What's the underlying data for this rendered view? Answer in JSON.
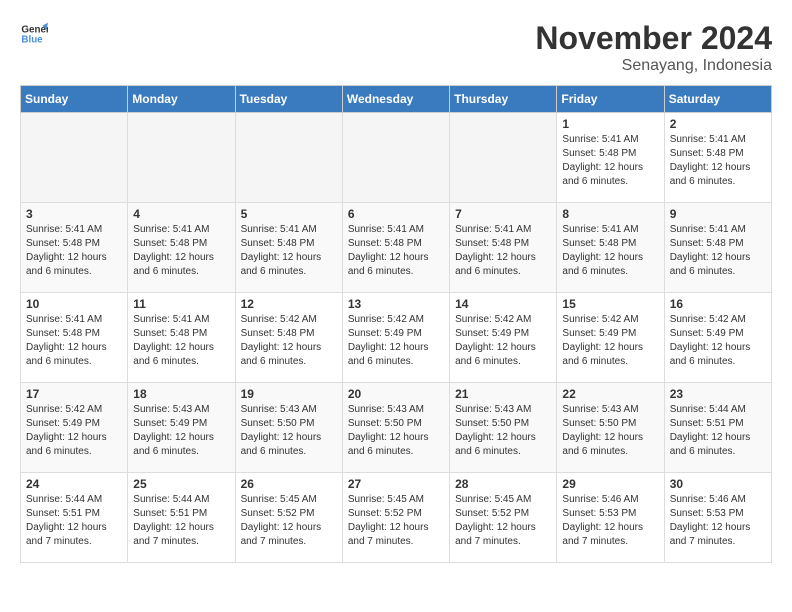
{
  "header": {
    "logo_line1": "General",
    "logo_line2": "Blue",
    "month": "November 2024",
    "location": "Senayang, Indonesia"
  },
  "days_of_week": [
    "Sunday",
    "Monday",
    "Tuesday",
    "Wednesday",
    "Thursday",
    "Friday",
    "Saturday"
  ],
  "weeks": [
    [
      {
        "day": "",
        "empty": true
      },
      {
        "day": "",
        "empty": true
      },
      {
        "day": "",
        "empty": true
      },
      {
        "day": "",
        "empty": true
      },
      {
        "day": "",
        "empty": true
      },
      {
        "day": "1",
        "sunrise": "5:41 AM",
        "sunset": "5:48 PM",
        "daylight": "12 hours and 6 minutes."
      },
      {
        "day": "2",
        "sunrise": "5:41 AM",
        "sunset": "5:48 PM",
        "daylight": "12 hours and 6 minutes."
      }
    ],
    [
      {
        "day": "3",
        "sunrise": "5:41 AM",
        "sunset": "5:48 PM",
        "daylight": "12 hours and 6 minutes."
      },
      {
        "day": "4",
        "sunrise": "5:41 AM",
        "sunset": "5:48 PM",
        "daylight": "12 hours and 6 minutes."
      },
      {
        "day": "5",
        "sunrise": "5:41 AM",
        "sunset": "5:48 PM",
        "daylight": "12 hours and 6 minutes."
      },
      {
        "day": "6",
        "sunrise": "5:41 AM",
        "sunset": "5:48 PM",
        "daylight": "12 hours and 6 minutes."
      },
      {
        "day": "7",
        "sunrise": "5:41 AM",
        "sunset": "5:48 PM",
        "daylight": "12 hours and 6 minutes."
      },
      {
        "day": "8",
        "sunrise": "5:41 AM",
        "sunset": "5:48 PM",
        "daylight": "12 hours and 6 minutes."
      },
      {
        "day": "9",
        "sunrise": "5:41 AM",
        "sunset": "5:48 PM",
        "daylight": "12 hours and 6 minutes."
      }
    ],
    [
      {
        "day": "10",
        "sunrise": "5:41 AM",
        "sunset": "5:48 PM",
        "daylight": "12 hours and 6 minutes."
      },
      {
        "day": "11",
        "sunrise": "5:41 AM",
        "sunset": "5:48 PM",
        "daylight": "12 hours and 6 minutes."
      },
      {
        "day": "12",
        "sunrise": "5:42 AM",
        "sunset": "5:48 PM",
        "daylight": "12 hours and 6 minutes."
      },
      {
        "day": "13",
        "sunrise": "5:42 AM",
        "sunset": "5:49 PM",
        "daylight": "12 hours and 6 minutes."
      },
      {
        "day": "14",
        "sunrise": "5:42 AM",
        "sunset": "5:49 PM",
        "daylight": "12 hours and 6 minutes."
      },
      {
        "day": "15",
        "sunrise": "5:42 AM",
        "sunset": "5:49 PM",
        "daylight": "12 hours and 6 minutes."
      },
      {
        "day": "16",
        "sunrise": "5:42 AM",
        "sunset": "5:49 PM",
        "daylight": "12 hours and 6 minutes."
      }
    ],
    [
      {
        "day": "17",
        "sunrise": "5:42 AM",
        "sunset": "5:49 PM",
        "daylight": "12 hours and 6 minutes."
      },
      {
        "day": "18",
        "sunrise": "5:43 AM",
        "sunset": "5:49 PM",
        "daylight": "12 hours and 6 minutes."
      },
      {
        "day": "19",
        "sunrise": "5:43 AM",
        "sunset": "5:50 PM",
        "daylight": "12 hours and 6 minutes."
      },
      {
        "day": "20",
        "sunrise": "5:43 AM",
        "sunset": "5:50 PM",
        "daylight": "12 hours and 6 minutes."
      },
      {
        "day": "21",
        "sunrise": "5:43 AM",
        "sunset": "5:50 PM",
        "daylight": "12 hours and 6 minutes."
      },
      {
        "day": "22",
        "sunrise": "5:43 AM",
        "sunset": "5:50 PM",
        "daylight": "12 hours and 6 minutes."
      },
      {
        "day": "23",
        "sunrise": "5:44 AM",
        "sunset": "5:51 PM",
        "daylight": "12 hours and 6 minutes."
      }
    ],
    [
      {
        "day": "24",
        "sunrise": "5:44 AM",
        "sunset": "5:51 PM",
        "daylight": "12 hours and 7 minutes."
      },
      {
        "day": "25",
        "sunrise": "5:44 AM",
        "sunset": "5:51 PM",
        "daylight": "12 hours and 7 minutes."
      },
      {
        "day": "26",
        "sunrise": "5:45 AM",
        "sunset": "5:52 PM",
        "daylight": "12 hours and 7 minutes."
      },
      {
        "day": "27",
        "sunrise": "5:45 AM",
        "sunset": "5:52 PM",
        "daylight": "12 hours and 7 minutes."
      },
      {
        "day": "28",
        "sunrise": "5:45 AM",
        "sunset": "5:52 PM",
        "daylight": "12 hours and 7 minutes."
      },
      {
        "day": "29",
        "sunrise": "5:46 AM",
        "sunset": "5:53 PM",
        "daylight": "12 hours and 7 minutes."
      },
      {
        "day": "30",
        "sunrise": "5:46 AM",
        "sunset": "5:53 PM",
        "daylight": "12 hours and 7 minutes."
      }
    ]
  ]
}
